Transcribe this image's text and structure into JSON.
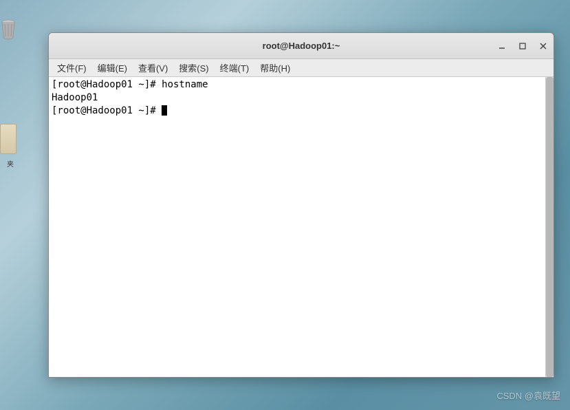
{
  "desktop": {
    "folder_label": "夹"
  },
  "window": {
    "title": "root@Hadoop01:~"
  },
  "menubar": {
    "items": [
      "文件(F)",
      "编辑(E)",
      "查看(V)",
      "搜索(S)",
      "终端(T)",
      "帮助(H)"
    ]
  },
  "terminal": {
    "lines": [
      "[root@Hadoop01 ~]# hostname",
      "Hadoop01",
      "[root@Hadoop01 ~]# "
    ]
  },
  "watermark": "CSDN @袁既望"
}
